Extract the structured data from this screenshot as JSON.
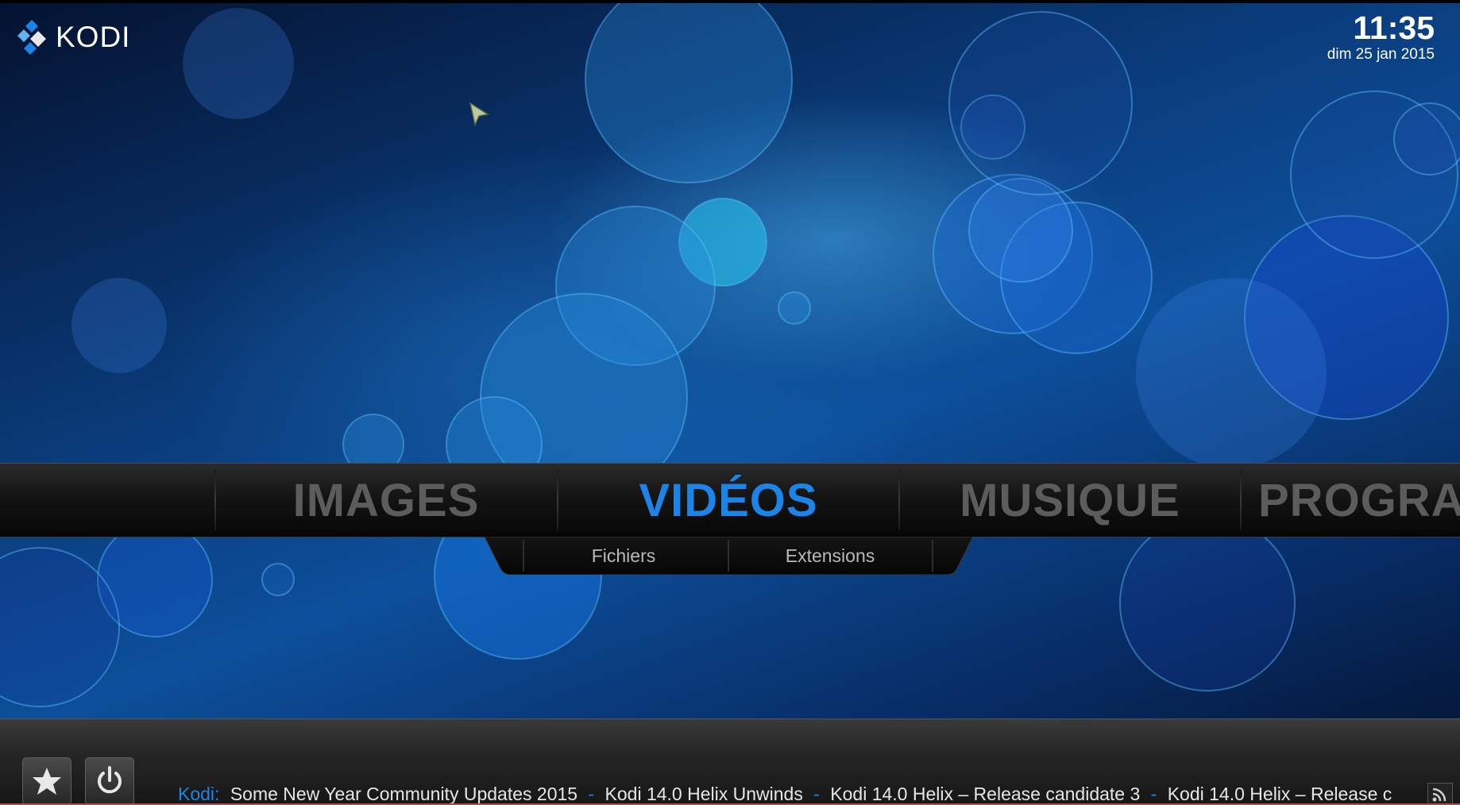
{
  "app": {
    "logo_text": "KODI"
  },
  "clock": {
    "time": "11:35",
    "date": "dim 25 jan 2015"
  },
  "main_menu": {
    "items": [
      "IMAGES",
      "VIDÉOS",
      "MUSIQUE",
      "PROGRAMMES"
    ],
    "selected": "VIDÉOS"
  },
  "submenu": {
    "items": [
      "Fichiers",
      "Extensions"
    ]
  },
  "bottom_buttons": [
    {
      "name": "favourites",
      "icon": "star-icon"
    },
    {
      "name": "power",
      "icon": "power-icon"
    }
  ],
  "ticker": {
    "source": "Kodi:",
    "items": [
      "Some New Year Community Updates 2015",
      "Kodi 14.0 Helix Unwinds",
      "Kodi 14.0 Helix – Release candidate 3",
      "Kodi 14.0 Helix – Release c"
    ],
    "separator": "-"
  },
  "colors": {
    "accent": "#1c84e6",
    "inactive_menu": "#5c5c5c",
    "submenu_text": "#b9b9b9"
  }
}
